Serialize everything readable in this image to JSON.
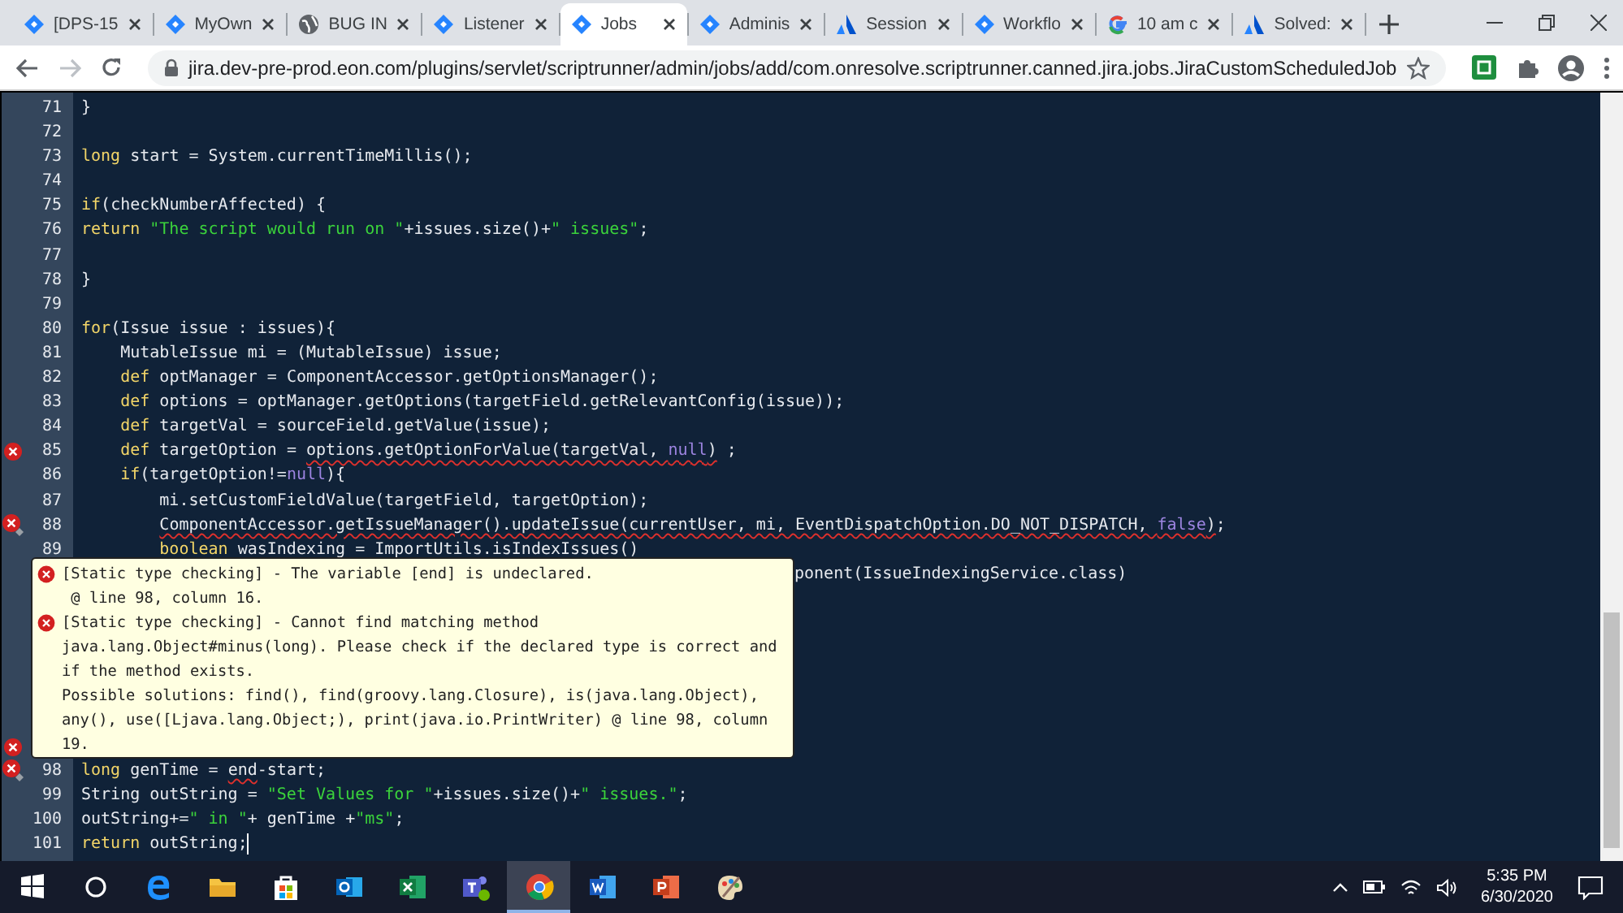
{
  "browser": {
    "tabs": [
      {
        "title": "[DPS-15",
        "kind": "jira",
        "selected": false
      },
      {
        "title": "MyOwn",
        "kind": "jira",
        "selected": false
      },
      {
        "title": "BUG IN",
        "kind": "globe",
        "selected": false
      },
      {
        "title": "Listener",
        "kind": "jira",
        "selected": false
      },
      {
        "title": "Jobs",
        "kind": "jira",
        "selected": true
      },
      {
        "title": "Adminis",
        "kind": "jira",
        "selected": false
      },
      {
        "title": "Session",
        "kind": "atlassian",
        "selected": false
      },
      {
        "title": "Workflo",
        "kind": "jira",
        "selected": false
      },
      {
        "title": "10 am c",
        "kind": "google",
        "selected": false
      },
      {
        "title": "Solved:",
        "kind": "atlassian",
        "selected": false
      }
    ],
    "address": "jira.dev-pre-prod.eon.com/plugins/servlet/scriptrunner/admin/jobs/add/com.onresolve.scriptrunner.canned.jira.jobs.JiraCustomScheduledJob"
  },
  "editor": {
    "lines_above": [
      {
        "number": "71",
        "tokens": [
          {
            "text": "}",
            "kind": "plain"
          }
        ]
      },
      {
        "number": "72"
      },
      {
        "number": "73",
        "tokens": [
          {
            "text": "long",
            "kind": "keyword"
          },
          {
            "text": " start = System.currentTimeMillis();",
            "kind": "plain"
          }
        ]
      },
      {
        "number": "74"
      },
      {
        "number": "75",
        "tokens": [
          {
            "text": "if",
            "kind": "keyword"
          },
          {
            "text": "(checkNumberAffected) {",
            "kind": "plain"
          }
        ]
      },
      {
        "number": "76",
        "tokens": [
          {
            "text": "return",
            "kind": "keyword"
          },
          {
            "text": " \"The script would run on \"",
            "kind": "string"
          },
          {
            "text": "+issues.size()+",
            "kind": "plain"
          },
          {
            "text": "\" issues\"",
            "kind": "string"
          },
          {
            "text": ";",
            "kind": "plain"
          }
        ]
      },
      {
        "number": "77"
      },
      {
        "number": "78",
        "tokens": [
          {
            "text": "}",
            "kind": "plain"
          }
        ]
      },
      {
        "number": "79"
      },
      {
        "number": "80",
        "tokens": [
          {
            "text": "for",
            "kind": "keyword"
          },
          {
            "text": "(Issue issue : issues){",
            "kind": "plain"
          }
        ]
      },
      {
        "number": "81",
        "tokens": [
          {
            "text": "    MutableIssue mi = (MutableIssue) issue;",
            "kind": "plain"
          }
        ]
      },
      {
        "number": "82",
        "tokens": [
          {
            "text": "    def",
            "kind": "keyword"
          },
          {
            "text": " optManager = ComponentAccessor.getOptionsManager();",
            "kind": "plain"
          }
        ]
      },
      {
        "number": "83",
        "tokens": [
          {
            "text": "    def",
            "kind": "keyword"
          },
          {
            "text": " options = optManager.getOptions(targetField.getRelevantConfig(issue));",
            "kind": "plain"
          }
        ]
      },
      {
        "number": "84",
        "tokens": [
          {
            "text": "    def",
            "kind": "keyword"
          },
          {
            "text": " targetVal = sourceField.getValue(issue);",
            "kind": "plain"
          }
        ]
      },
      {
        "number": "85",
        "error": true,
        "tokens": [
          {
            "text": "    def",
            "kind": "keyword"
          },
          {
            "text": " targetOption = ",
            "kind": "plain"
          },
          {
            "text": "options.getOptionForValue(targetVal, ",
            "kind": "plain",
            "squiggle": true
          },
          {
            "text": "null",
            "kind": "literal",
            "squiggle": true
          },
          {
            "text": ")",
            "kind": "plain",
            "squiggle": true
          },
          {
            "text": " ;",
            "kind": "plain"
          }
        ]
      },
      {
        "number": "86",
        "tokens": [
          {
            "text": "    if",
            "kind": "keyword"
          },
          {
            "text": "(targetOption!=",
            "kind": "plain"
          },
          {
            "text": "null",
            "kind": "literal"
          },
          {
            "text": "){",
            "kind": "plain"
          }
        ]
      },
      {
        "number": "87",
        "tokens": [
          {
            "text": "        mi.setCustomFieldValue(targetField, targetOption);",
            "kind": "plain"
          }
        ]
      },
      {
        "number": "88",
        "error": true,
        "quick_fix": true,
        "tokens": [
          {
            "text": "        ComponentAccessor.getIssueManager().updateIssue(currentUser, mi, EventDispatchOption.DO_NOT_DISPATCH, ",
            "kind": "plain",
            "squiggle": true
          },
          {
            "text": "false",
            "kind": "literal",
            "squiggle": true
          },
          {
            "text": ")",
            "kind": "plain",
            "squiggle": true
          },
          {
            "text": ";",
            "kind": "plain"
          }
        ]
      },
      {
        "number": "89",
        "tokens": [
          {
            "text": "        boolean",
            "kind": "keyword"
          },
          {
            "text": " wasIndexing = ImportUtils.isIndexIssues()",
            "kind": "plain"
          }
        ]
      }
    ],
    "covered": {
      "partial_text": "ponent(IssueIndexingService.class)",
      "error": true
    },
    "tooltip": {
      "messages": [
        {
          "text": "[Static type checking] - The variable [end] is undeclared.\n @ line 98, column 16."
        },
        {
          "text": "[Static type checking] - Cannot find matching method java.lang.Object#minus(long). Please check if the declared type is correct and if the method exists.\nPossible solutions: find(), find(groovy.lang.Closure), is(java.lang.Object), any(), use([Ljava.lang.Object;), print(java.io.PrintWriter) @ line 98, column 19."
        }
      ]
    },
    "lines_below": [
      {
        "number": "98",
        "error": true,
        "quick_fix": true,
        "tokens": [
          {
            "text": "long",
            "kind": "keyword"
          },
          {
            "text": " genTime = ",
            "kind": "plain"
          },
          {
            "text": "end",
            "kind": "plain",
            "squiggle": true
          },
          {
            "text": "-start;",
            "kind": "plain"
          }
        ]
      },
      {
        "number": "99",
        "tokens": [
          {
            "text": "String outString = ",
            "kind": "plain"
          },
          {
            "text": "\"Set Values for \"",
            "kind": "string"
          },
          {
            "text": "+issues.size()+",
            "kind": "plain"
          },
          {
            "text": "\" issues.\"",
            "kind": "string"
          },
          {
            "text": ";",
            "kind": "plain"
          }
        ]
      },
      {
        "number": "100",
        "tokens": [
          {
            "text": "outString+=",
            "kind": "plain"
          },
          {
            "text": "\" in \"",
            "kind": "string"
          },
          {
            "text": "+ genTime +",
            "kind": "plain"
          },
          {
            "text": "\"ms\"",
            "kind": "string"
          },
          {
            "text": ";",
            "kind": "plain"
          }
        ]
      },
      {
        "number": "101",
        "cursor": true,
        "tokens": [
          {
            "text": "return",
            "kind": "keyword"
          },
          {
            "text": " outString;",
            "kind": "plain"
          }
        ]
      }
    ]
  },
  "taskbar": {
    "apps": [
      {
        "kind": "start",
        "selected": false
      },
      {
        "kind": "search",
        "selected": false
      },
      {
        "kind": "edge",
        "selected": false
      },
      {
        "kind": "explorer",
        "selected": false
      },
      {
        "kind": "store",
        "selected": false
      },
      {
        "kind": "outlook",
        "selected": false
      },
      {
        "kind": "excel",
        "selected": false
      },
      {
        "kind": "teams",
        "selected": false
      },
      {
        "kind": "chrome",
        "selected": true
      },
      {
        "kind": "word",
        "selected": false
      },
      {
        "kind": "powerpoint",
        "selected": false
      },
      {
        "kind": "paint",
        "selected": false
      }
    ],
    "time": "5:35 PM",
    "date": "6/30/2020"
  }
}
